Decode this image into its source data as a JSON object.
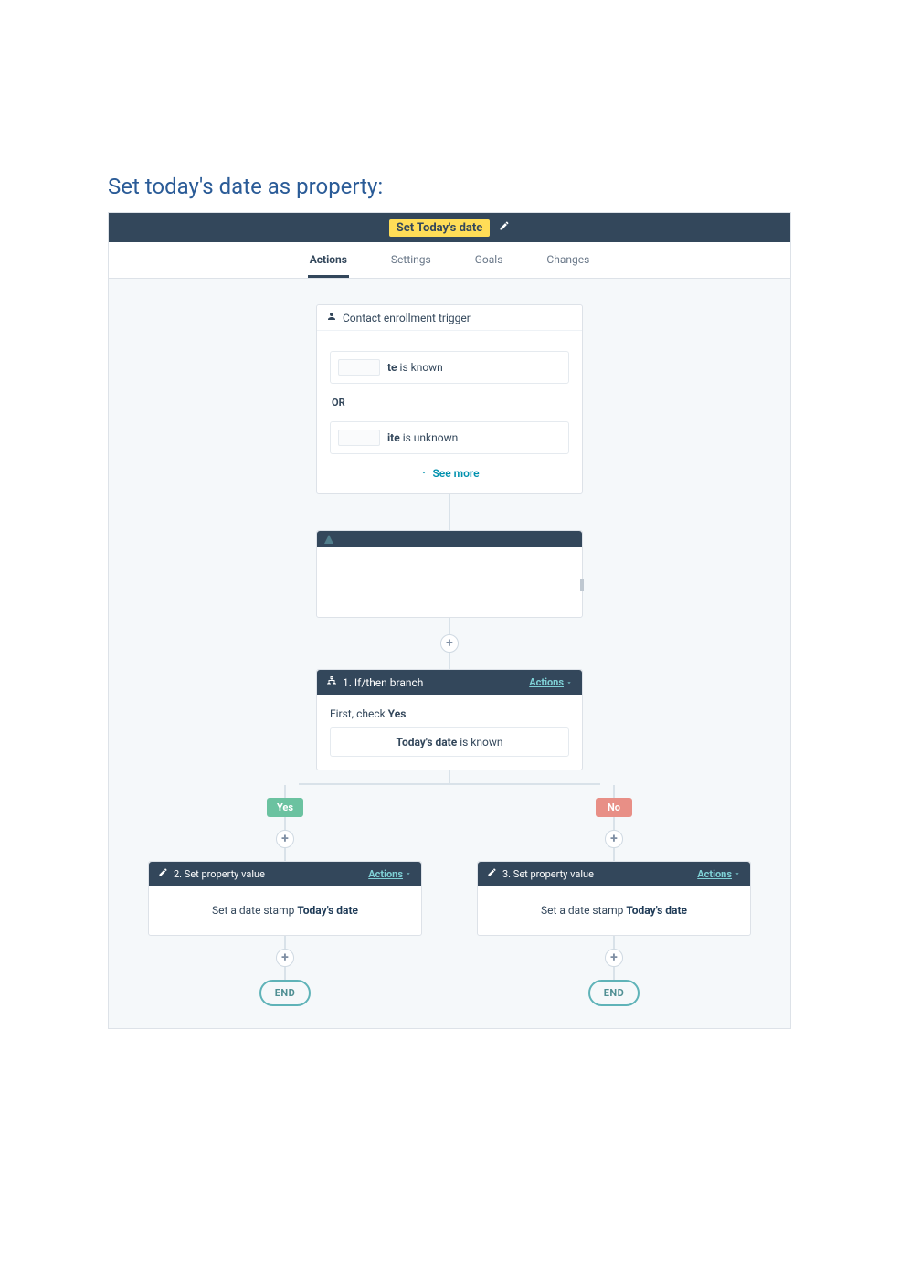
{
  "page": {
    "heading": "Set today's date as property:"
  },
  "header": {
    "title": "Set Today's date"
  },
  "tabs": {
    "items": [
      {
        "label": "Actions",
        "active": true
      },
      {
        "label": "Settings",
        "active": false
      },
      {
        "label": "Goals",
        "active": false
      },
      {
        "label": "Changes",
        "active": false
      }
    ]
  },
  "enrollment": {
    "title": "Contact enrollment trigger",
    "conditions": [
      {
        "suffix_bold": "te",
        "suffix_rest": " is known"
      },
      {
        "suffix_bold": "ite",
        "suffix_rest": " is unknown"
      }
    ],
    "or_label": "OR",
    "see_more": "See more"
  },
  "branch": {
    "title": "1. If/then branch",
    "actions_label": "Actions",
    "first_check_prefix": "First, check ",
    "first_check_value": "Yes",
    "condition_bold": "Today's date",
    "condition_rest": " is known",
    "yes_label": "Yes",
    "no_label": "No"
  },
  "set_property_nodes": {
    "left": {
      "title": "2. Set property value",
      "actions_label": "Actions",
      "body_prefix": "Set a date stamp ",
      "body_value": "Today's date"
    },
    "right": {
      "title": "3. Set property value",
      "actions_label": "Actions",
      "body_prefix": "Set a date stamp ",
      "body_value": "Today's date"
    }
  },
  "end_label": "END",
  "plus_label": "+"
}
